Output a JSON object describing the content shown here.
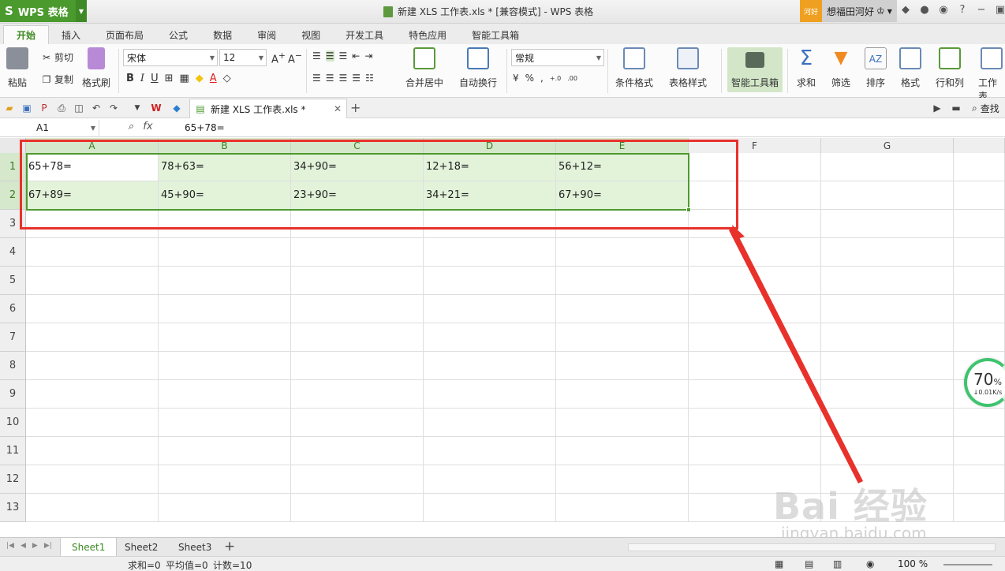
{
  "app": {
    "name": "WPS 表格",
    "window_title": "新建 XLS 工作表.xls * [兼容模式] - WPS 表格",
    "user_tag": "河好",
    "user_name": "想福田河好"
  },
  "ribbon_tabs": [
    "开始",
    "插入",
    "页面布局",
    "公式",
    "数据",
    "审阅",
    "视图",
    "开发工具",
    "特色应用",
    "智能工具箱"
  ],
  "ribbon": {
    "paste": "粘贴",
    "cut": "剪切",
    "copy": "复制",
    "format_painter": "格式刷",
    "font_name": "宋体",
    "font_size": "12",
    "merge_center": "合并居中",
    "wrap_text": "自动换行",
    "number_format": "常规",
    "percent": "%",
    "conditional_format": "条件格式",
    "table_style": "表格样式",
    "smart_toolbox": "智能工具箱",
    "sum": "求和",
    "filter": "筛选",
    "sort": "排序",
    "format": "格式",
    "rows_cols": "行和列",
    "worksheet": "工作表"
  },
  "doc_tab": "新建 XLS 工作表.xls *",
  "find_label": "查找",
  "formula_bar": {
    "name_box": "A1",
    "fx": "fx",
    "value": "65+78="
  },
  "columns": [
    "A",
    "B",
    "C",
    "D",
    "E",
    "F",
    "G"
  ],
  "rows": [
    "1",
    "2",
    "3",
    "4",
    "5",
    "6",
    "7",
    "8",
    "9",
    "10",
    "11",
    "12",
    "13"
  ],
  "cells": [
    [
      "65+78=",
      "78+63=",
      "34+90=",
      "12+18=",
      "56+12="
    ],
    [
      "67+89=",
      "45+90=",
      "23+90=",
      "34+21=",
      "67+90="
    ]
  ],
  "net_widget": {
    "percent": "70",
    "percent_sign": "%",
    "speed": "↓0.01K/s"
  },
  "sheets": [
    "Sheet1",
    "Sheet2",
    "Sheet3"
  ],
  "status": {
    "sum": "求和=0",
    "average": "平均值=0",
    "count": "计数=10",
    "zoom": "100 %"
  },
  "watermark": {
    "brand": "Bai 经验",
    "url": "jingyan.baidu.com"
  },
  "colors": {
    "accent": "#4a9a2e",
    "selection_fill": "#e3f3da",
    "annotation_red": "#e8312b"
  }
}
